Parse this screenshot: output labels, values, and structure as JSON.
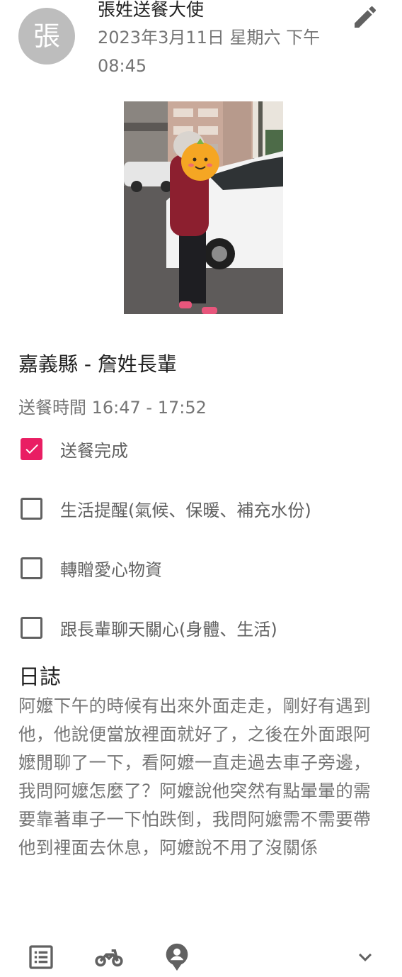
{
  "post": {
    "avatar_char": "張",
    "author": "張姓送餐大使",
    "datetime": "2023年3月11日 星期六 下午08:45",
    "title": "嘉義縣 - 詹姓長輩",
    "delivery_time": "送餐時間 16:47 - 17:52"
  },
  "checklist": [
    {
      "label": "送餐完成",
      "checked": true
    },
    {
      "label": "生活提醒(氣候、保暖、補充水份)",
      "checked": false
    },
    {
      "label": "轉贈愛心物資",
      "checked": false
    },
    {
      "label": "跟長輩聊天關心(身體、生活)",
      "checked": false
    }
  ],
  "log": {
    "heading": "日誌",
    "body": "阿嬤下午的時候有出來外面走走，剛好有遇到他，他說便當放裡面就好了，之後在外面跟阿嬤閒聊了一下，看阿嬤一直走過去車子旁邊，我問阿嬤怎麼了？阿嬤說他突然有點暈暈的需要靠著車子一下怕跌倒，我問阿嬤需不需要帶他到裡面去休息，阿嬤說不用了沒關係"
  },
  "icons": {
    "edit": "pencil-icon",
    "list": "list-icon",
    "delivery": "motorcycle-icon",
    "profile": "person-pin-icon",
    "expand": "chevron-down-icon"
  },
  "colors": {
    "accent": "#e91e63",
    "icon": "#616161",
    "muted_text": "#757575",
    "avatar_bg": "#bdbdbd"
  }
}
